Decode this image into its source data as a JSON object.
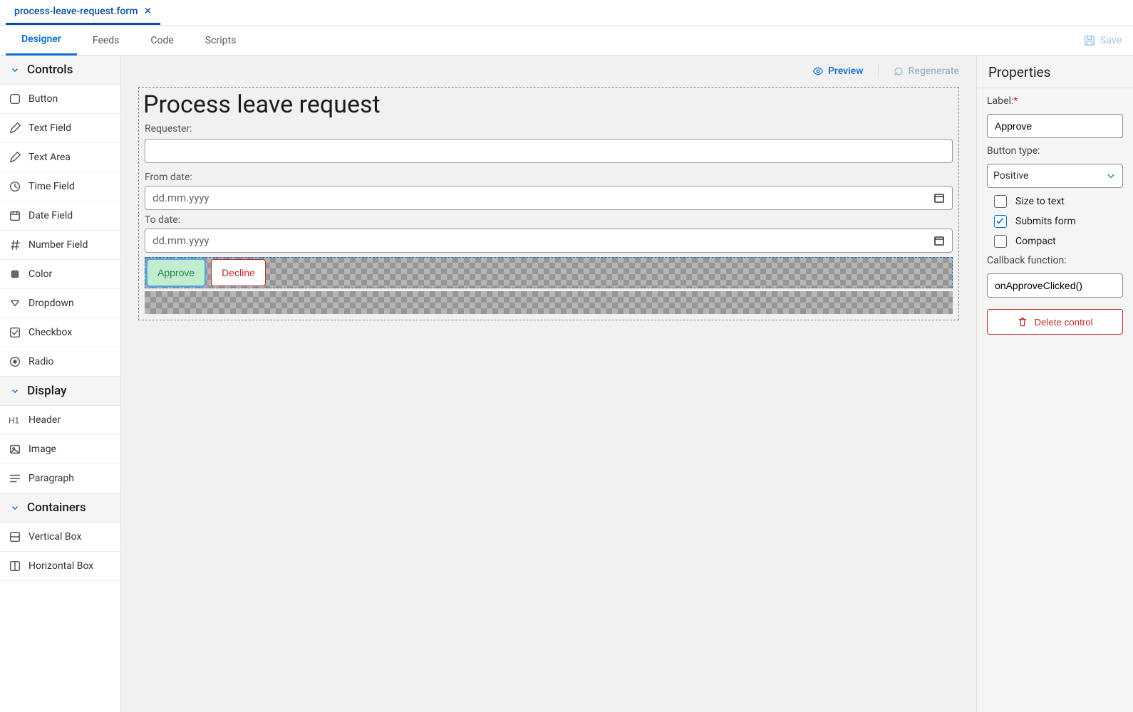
{
  "file_tabs": [
    {
      "name": "process-leave-request.form",
      "active": true
    }
  ],
  "editor_tabs": {
    "items": [
      "Designer",
      "Feeds",
      "Code",
      "Scripts"
    ],
    "active": "Designer",
    "save_label": "Save"
  },
  "palette": {
    "groups": [
      {
        "title": "Controls",
        "items": [
          {
            "label": "Button",
            "icon": "square"
          },
          {
            "label": "Text Field",
            "icon": "pencil"
          },
          {
            "label": "Text Area",
            "icon": "pencil"
          },
          {
            "label": "Time Field",
            "icon": "clock"
          },
          {
            "label": "Date Field",
            "icon": "calendar"
          },
          {
            "label": "Number Field",
            "icon": "hash"
          },
          {
            "label": "Color",
            "icon": "swatch"
          },
          {
            "label": "Dropdown",
            "icon": "chevdown"
          },
          {
            "label": "Checkbox",
            "icon": "check"
          },
          {
            "label": "Radio",
            "icon": "radio"
          }
        ]
      },
      {
        "title": "Display",
        "items": [
          {
            "label": "Header",
            "icon": "h1"
          },
          {
            "label": "Image",
            "icon": "image"
          },
          {
            "label": "Paragraph",
            "icon": "para"
          }
        ]
      },
      {
        "title": "Containers",
        "items": [
          {
            "label": "Vertical Box",
            "icon": "vbox"
          },
          {
            "label": "Horizontal Box",
            "icon": "hbox"
          }
        ]
      }
    ]
  },
  "canvas_actions": {
    "preview": "Preview",
    "regenerate": "Regenerate"
  },
  "form": {
    "title": "Process leave request",
    "fields": {
      "requester_label": "Requester:",
      "from_label": "From date:",
      "to_label": "To date:",
      "date_placeholder": "dd.mm.yyyy"
    },
    "buttons": {
      "approve": "Approve",
      "decline": "Decline"
    }
  },
  "properties": {
    "title": "Properties",
    "label_label": "Label:",
    "label_value": "Approve",
    "button_type_label": "Button type:",
    "button_type_value": "Positive",
    "size_to_text": {
      "label": "Size to text",
      "checked": false
    },
    "submits_form": {
      "label": "Submits form",
      "checked": true
    },
    "compact": {
      "label": "Compact",
      "checked": false
    },
    "callback_label": "Callback function:",
    "callback_value": "onApproveClicked()",
    "delete_label": "Delete control"
  }
}
